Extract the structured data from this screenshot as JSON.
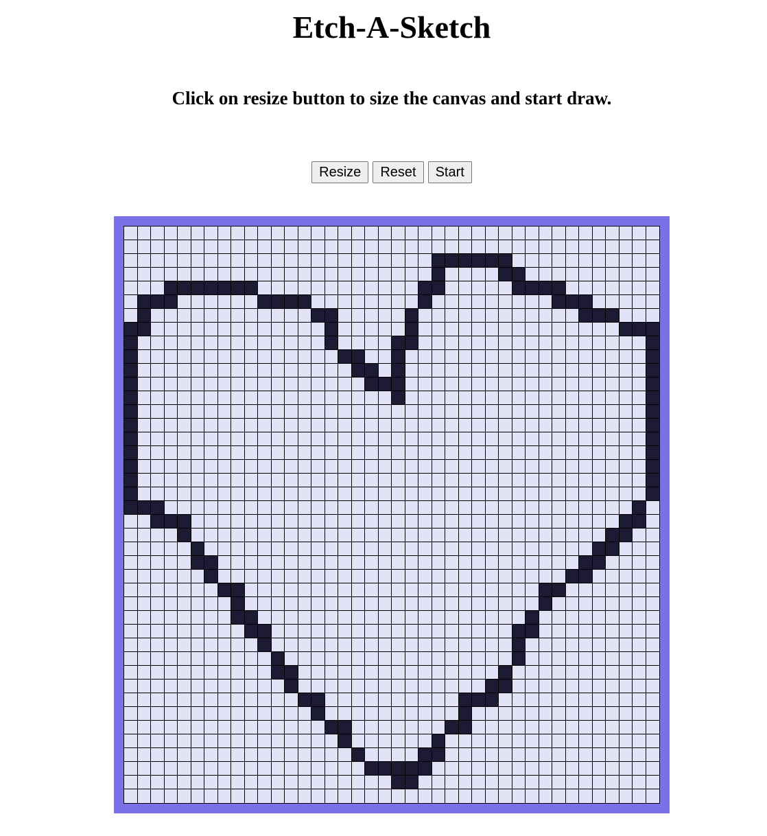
{
  "page": {
    "title": "Etch-A-Sketch",
    "instructions": "Click on resize button to size the canvas and start draw."
  },
  "controls": {
    "resize_label": "Resize",
    "reset_label": "Reset",
    "start_label": "Start"
  },
  "canvas": {
    "columns": 40,
    "rows": 42,
    "frame_color": "#7a70e8",
    "cell_color": "#e3e3f8",
    "ink_color": "#1d1b33",
    "filled_cells": [
      [
        2,
        23
      ],
      [
        2,
        24
      ],
      [
        2,
        25
      ],
      [
        2,
        26
      ],
      [
        2,
        27
      ],
      [
        2,
        28
      ],
      [
        3,
        23
      ],
      [
        3,
        28
      ],
      [
        3,
        29
      ],
      [
        4,
        3
      ],
      [
        4,
        4
      ],
      [
        4,
        5
      ],
      [
        4,
        6
      ],
      [
        4,
        7
      ],
      [
        4,
        8
      ],
      [
        4,
        9
      ],
      [
        4,
        22
      ],
      [
        4,
        23
      ],
      [
        4,
        29
      ],
      [
        4,
        30
      ],
      [
        4,
        31
      ],
      [
        4,
        32
      ],
      [
        5,
        1
      ],
      [
        5,
        2
      ],
      [
        5,
        3
      ],
      [
        5,
        10
      ],
      [
        5,
        11
      ],
      [
        5,
        12
      ],
      [
        5,
        13
      ],
      [
        5,
        22
      ],
      [
        5,
        32
      ],
      [
        5,
        33
      ],
      [
        5,
        34
      ],
      [
        6,
        1
      ],
      [
        6,
        14
      ],
      [
        6,
        15
      ],
      [
        6,
        21
      ],
      [
        6,
        34
      ],
      [
        6,
        35
      ],
      [
        6,
        36
      ],
      [
        7,
        0
      ],
      [
        7,
        1
      ],
      [
        7,
        15
      ],
      [
        7,
        21
      ],
      [
        7,
        37
      ],
      [
        7,
        38
      ],
      [
        7,
        39
      ],
      [
        8,
        0
      ],
      [
        8,
        15
      ],
      [
        8,
        20
      ],
      [
        8,
        21
      ],
      [
        8,
        39
      ],
      [
        9,
        0
      ],
      [
        9,
        16
      ],
      [
        9,
        17
      ],
      [
        9,
        20
      ],
      [
        9,
        39
      ],
      [
        10,
        0
      ],
      [
        10,
        17
      ],
      [
        10,
        18
      ],
      [
        10,
        20
      ],
      [
        10,
        39
      ],
      [
        11,
        0
      ],
      [
        11,
        18
      ],
      [
        11,
        19
      ],
      [
        11,
        20
      ],
      [
        11,
        39
      ],
      [
        12,
        0
      ],
      [
        12,
        20
      ],
      [
        12,
        39
      ],
      [
        13,
        0
      ],
      [
        13,
        39
      ],
      [
        14,
        0
      ],
      [
        14,
        39
      ],
      [
        15,
        0
      ],
      [
        15,
        39
      ],
      [
        16,
        0
      ],
      [
        16,
        39
      ],
      [
        17,
        0
      ],
      [
        17,
        39
      ],
      [
        18,
        0
      ],
      [
        18,
        39
      ],
      [
        19,
        0
      ],
      [
        19,
        39
      ],
      [
        20,
        0
      ],
      [
        20,
        1
      ],
      [
        20,
        2
      ],
      [
        20,
        38
      ],
      [
        21,
        2
      ],
      [
        21,
        3
      ],
      [
        21,
        4
      ],
      [
        21,
        37
      ],
      [
        21,
        38
      ],
      [
        22,
        4
      ],
      [
        22,
        36
      ],
      [
        22,
        37
      ],
      [
        23,
        5
      ],
      [
        23,
        35
      ],
      [
        23,
        36
      ],
      [
        24,
        5
      ],
      [
        24,
        6
      ],
      [
        24,
        34
      ],
      [
        24,
        35
      ],
      [
        25,
        6
      ],
      [
        25,
        33
      ],
      [
        25,
        34
      ],
      [
        26,
        7
      ],
      [
        26,
        8
      ],
      [
        26,
        31
      ],
      [
        26,
        32
      ],
      [
        27,
        8
      ],
      [
        27,
        31
      ],
      [
        28,
        8
      ],
      [
        28,
        9
      ],
      [
        28,
        30
      ],
      [
        29,
        9
      ],
      [
        29,
        10
      ],
      [
        29,
        29
      ],
      [
        29,
        30
      ],
      [
        30,
        10
      ],
      [
        30,
        29
      ],
      [
        31,
        11
      ],
      [
        31,
        29
      ],
      [
        32,
        11
      ],
      [
        32,
        12
      ],
      [
        32,
        28
      ],
      [
        33,
        12
      ],
      [
        33,
        27
      ],
      [
        33,
        28
      ],
      [
        34,
        13
      ],
      [
        34,
        14
      ],
      [
        34,
        25
      ],
      [
        34,
        26
      ],
      [
        34,
        27
      ],
      [
        35,
        14
      ],
      [
        35,
        25
      ],
      [
        36,
        15
      ],
      [
        36,
        16
      ],
      [
        36,
        24
      ],
      [
        36,
        25
      ],
      [
        37,
        16
      ],
      [
        37,
        23
      ],
      [
        38,
        17
      ],
      [
        38,
        22
      ],
      [
        38,
        23
      ],
      [
        39,
        18
      ],
      [
        39,
        19
      ],
      [
        39,
        20
      ],
      [
        39,
        21
      ],
      [
        39,
        22
      ],
      [
        40,
        20
      ],
      [
        40,
        21
      ]
    ]
  }
}
